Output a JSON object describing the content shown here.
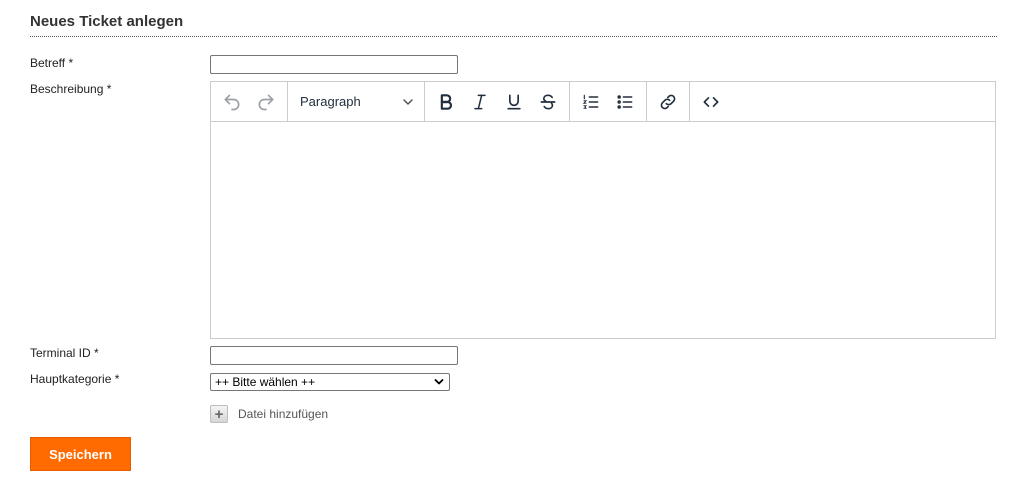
{
  "form": {
    "title": "Neues Ticket anlegen",
    "subject_label": "Betreff *",
    "subject_value": "",
    "description_label": "Beschreibung *",
    "terminal_label": "Terminal ID *",
    "terminal_value": "",
    "category_label": "Hauptkategorie *",
    "category_selected": "++ Bitte wählen ++",
    "attach_label": "Datei hinzufügen",
    "save_label": "Speichern"
  },
  "editor": {
    "block_format": "Paragraph",
    "toolbar_icons": [
      "undo-icon",
      "redo-icon",
      "chevron-down-icon",
      "bold-icon",
      "italic-icon",
      "underline-icon",
      "strikethrough-icon",
      "numbered-list-icon",
      "bullet-list-icon",
      "link-icon",
      "source-code-icon"
    ],
    "content": ""
  },
  "colors": {
    "accent": "#ff6b00",
    "border": "#cccccc"
  }
}
